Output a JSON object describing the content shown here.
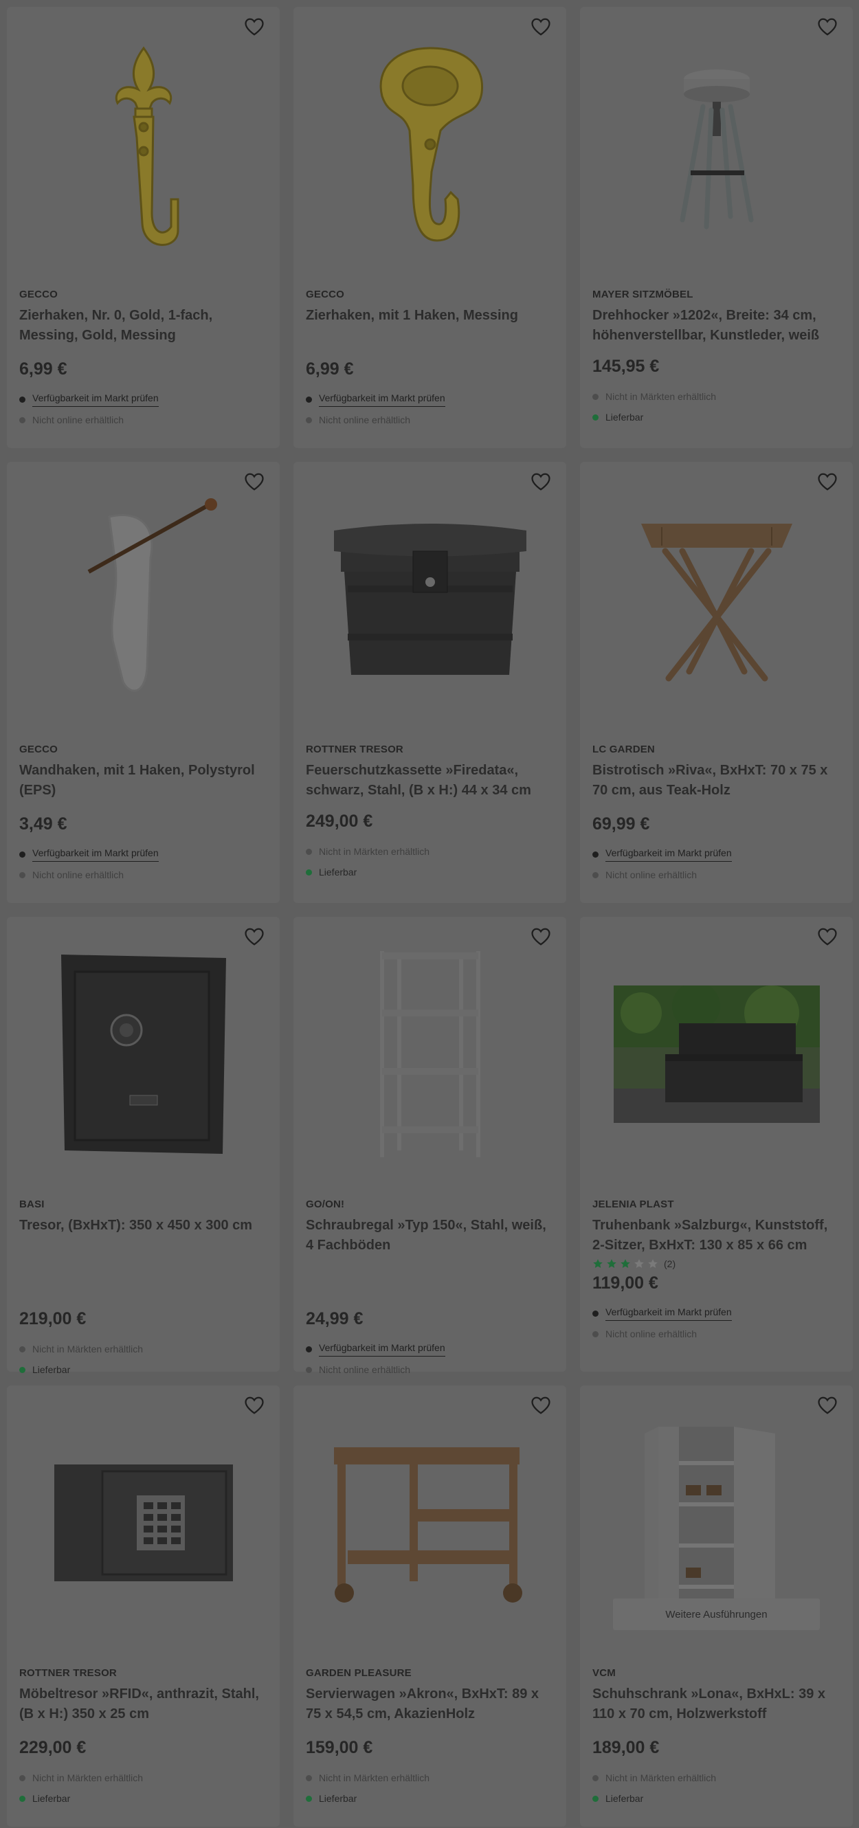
{
  "products": [
    {
      "brand": "GECCO",
      "title": "Zierhaken, Nr. 0, Gold, 1-fach, Messing, Gold, Messing",
      "price": "6,99 €",
      "status": [
        {
          "type": "link",
          "text": "Verfügbarkeit im Markt prüfen"
        },
        {
          "type": "muted",
          "text": "Nicht online erhältlich"
        }
      ],
      "image": "fleur-de-lis-brass-hook-image"
    },
    {
      "brand": "GECCO",
      "title": "Zierhaken, mit 1 Haken, Messing",
      "price": "6,99 €",
      "status": [
        {
          "type": "link",
          "text": "Verfügbarkeit im Markt prüfen"
        },
        {
          "type": "muted",
          "text": "Nicht online erhältlich"
        }
      ],
      "image": "ornate-brass-hook-image"
    },
    {
      "brand": "MAYER SITZMÖBEL",
      "title": "Drehhocker »1202«, Breite: 34 cm, höhenverstellbar, Kunstleder, weiß",
      "price": "145,95 €",
      "status": [
        {
          "type": "muted",
          "text": "Nicht in Märkten erhältlich"
        },
        {
          "type": "ok",
          "text": "Lieferbar"
        }
      ],
      "image": "swivel-stool-image"
    },
    {
      "brand": "GECCO",
      "title": "Wandhaken, mit 1 Haken, Polystyrol (EPS)",
      "price": "3,49 €",
      "status": [
        {
          "type": "link",
          "text": "Verfügbarkeit im Markt prüfen"
        },
        {
          "type": "muted",
          "text": "Nicht online erhältlich"
        }
      ],
      "image": "clear-wall-hook-image"
    },
    {
      "brand": "ROTTNER TRESOR",
      "title": "Feuerschutzkassette »Firedata«, schwarz, Stahl, (B x H:) 44 x 34 cm",
      "price": "249,00 €",
      "status": [
        {
          "type": "muted",
          "text": "Nicht in Märkten erhältlich"
        },
        {
          "type": "ok",
          "text": "Lieferbar"
        }
      ],
      "image": "fire-safe-box-image"
    },
    {
      "brand": "LC GARDEN",
      "title": "Bistrotisch »Riva«, BxHxT: 70 x 75 x 70 cm, aus Teak-Holz",
      "price": "69,99 €",
      "status": [
        {
          "type": "link",
          "text": "Verfügbarkeit im Markt prüfen"
        },
        {
          "type": "muted",
          "text": "Nicht online erhältlich"
        }
      ],
      "image": "folding-bistro-table-image"
    },
    {
      "brand": "BASI",
      "title": "Tresor, (BxHxT): 350 x 450 x 300 cm",
      "price": "219,00 €",
      "status": [
        {
          "type": "muted",
          "text": "Nicht in Märkten erhältlich"
        },
        {
          "type": "ok",
          "text": "Lieferbar"
        }
      ],
      "image": "safe-image"
    },
    {
      "brand": "GO/ON!",
      "title": "Schraubregal »Typ 150«, Stahl, weiß, 4 Fachböden",
      "price": "24,99 €",
      "status": [
        {
          "type": "link",
          "text": "Verfügbarkeit im Markt prüfen"
        },
        {
          "type": "muted",
          "text": "Nicht online erhältlich"
        }
      ],
      "image": "steel-shelf-image"
    },
    {
      "brand": "JELENIA PLAST",
      "title": "Truhenbank »Salzburg«, Kunststoff, 2-Sitzer, BxHxT: 130 x 85 x 66 cm",
      "rating": {
        "stars": 3,
        "max": 5,
        "count": "(2)"
      },
      "price": "119,00 €",
      "status": [
        {
          "type": "link",
          "text": "Verfügbarkeit im Markt prüfen"
        },
        {
          "type": "muted",
          "text": "Nicht online erhältlich"
        }
      ],
      "image": "storage-bench-image"
    },
    {
      "brand": "ROTTNER TRESOR",
      "title": "Möbeltresor »RFID«, anthrazit, Stahl, (B x H:) 350 x 25 cm",
      "price": "229,00 €",
      "status": [
        {
          "type": "muted",
          "text": "Nicht in Märkten erhältlich"
        },
        {
          "type": "ok",
          "text": "Lieferbar"
        }
      ],
      "image": "furniture-safe-image"
    },
    {
      "brand": "GARDEN PLEASURE",
      "title": "Servierwagen »Akron«, BxHxT: 89 x 75 x 54,5 cm, AkazienHolz",
      "price": "159,00 €",
      "status": [
        {
          "type": "muted",
          "text": "Nicht in Märkten erhältlich"
        },
        {
          "type": "ok",
          "text": "Lieferbar"
        }
      ],
      "image": "serving-cart-image"
    },
    {
      "brand": "VCM",
      "title": "Schuhschrank »Lona«, BxHxL: 39 x 110 x 70 cm, Holzwerkstoff",
      "price": "189,00 €",
      "status": [
        {
          "type": "muted",
          "text": "Nicht in Märkten erhältlich"
        },
        {
          "type": "ok",
          "text": "Lieferbar"
        }
      ],
      "image": "shoe-cabinet-image",
      "more_label": "Weitere Ausführungen"
    }
  ],
  "colors": {
    "overlay": "#5f5f5f",
    "card": "#656565",
    "available": "#1f6e3a"
  }
}
